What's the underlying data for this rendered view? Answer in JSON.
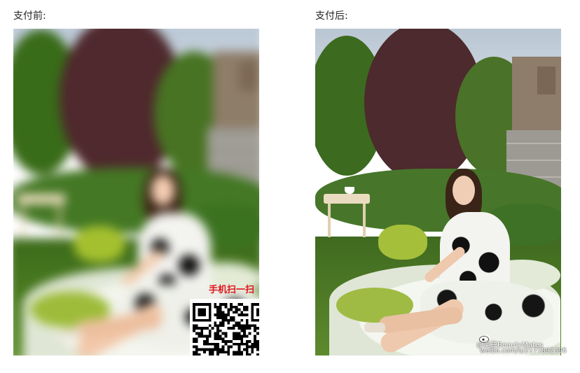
{
  "labels": {
    "before": "支付前:",
    "after": "支付后:"
  },
  "overlay": {
    "scan_text": "手机扫一扫"
  },
  "watermark": {
    "user": "@美兹BeautyMates",
    "url": "weibo.com/u/2177892395"
  },
  "colors": {
    "scan_text": "#e0141c"
  },
  "icons": {
    "qr": "qr-code-icon",
    "weibo": "weibo-icon"
  }
}
